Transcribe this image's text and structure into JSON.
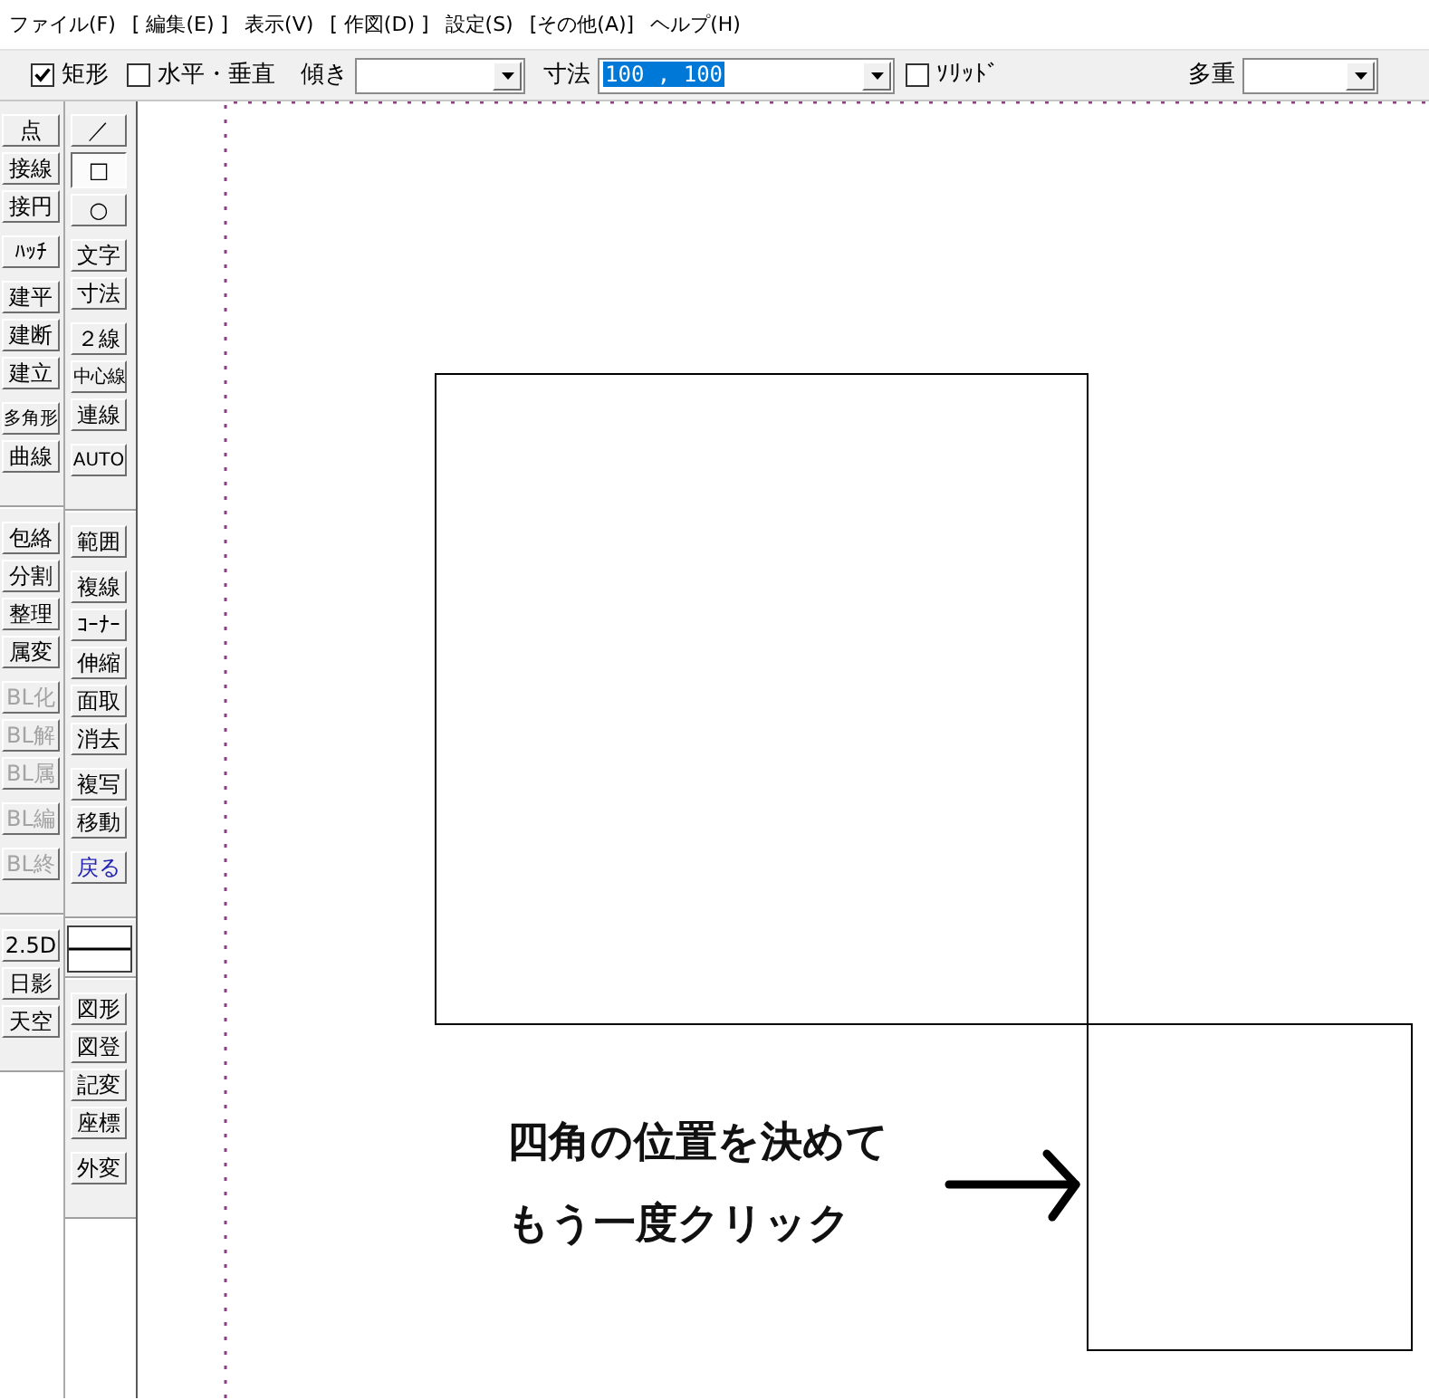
{
  "menu": [
    "ファイル(F)",
    "[ 編集(E) ]",
    "表示(V)",
    "[ 作図(D) ]",
    "設定(S)",
    "[その他(A)]",
    "ヘルプ(H)"
  ],
  "toolbar": {
    "left": [
      {
        "kind": "checkbox",
        "label": "矩形",
        "checked": true
      },
      {
        "kind": "checkbox",
        "label": "水平・垂直",
        "checked": false
      },
      {
        "kind": "combo",
        "label": "傾き"
      },
      {
        "kind": "combo",
        "label": "寸法",
        "value": "100 , 100",
        "highlighted": true
      },
      {
        "kind": "checkbox",
        "label": "ｿﾘｯﾄﾞ",
        "checked": false
      }
    ],
    "right": [
      {
        "kind": "combo",
        "label": "多重"
      }
    ]
  },
  "tool_columns": [
    {
      "groups": [
        {
          "kind": "buttons",
          "blocks": [
            [
              {
                "label": "点",
                "selected": false,
                "disabled": false
              },
              {
                "label": "接線",
                "selected": false,
                "disabled": false
              },
              {
                "label": "接円",
                "selected": false,
                "disabled": false
              }
            ],
            [
              {
                "label": "ﾊｯﾁ",
                "selected": false,
                "disabled": false
              }
            ],
            [
              {
                "label": "建平",
                "selected": false,
                "disabled": false
              },
              {
                "label": "建断",
                "selected": false,
                "disabled": false
              },
              {
                "label": "建立",
                "selected": false,
                "disabled": false
              }
            ],
            [
              {
                "label": "多角形",
                "selected": false,
                "disabled": false
              },
              {
                "label": "曲線",
                "selected": false,
                "disabled": false
              }
            ]
          ]
        },
        {
          "kind": "buttons",
          "blocks": [
            [
              {
                "label": "包絡",
                "selected": false,
                "disabled": false
              },
              {
                "label": "分割",
                "selected": false,
                "disabled": false
              },
              {
                "label": "整理",
                "selected": false,
                "disabled": false
              },
              {
                "label": "属変",
                "selected": false,
                "disabled": false
              }
            ],
            [
              {
                "label": "BL化",
                "selected": false,
                "disabled": true
              },
              {
                "label": "BL解",
                "selected": false,
                "disabled": true
              },
              {
                "label": "BL属",
                "selected": false,
                "disabled": true
              }
            ],
            [
              {
                "label": "BL編",
                "selected": false,
                "disabled": true
              }
            ],
            [
              {
                "label": "BL終",
                "selected": false,
                "disabled": true
              }
            ]
          ]
        },
        {
          "kind": "buttons",
          "blocks": [
            [
              {
                "label": "2.5D",
                "selected": false,
                "disabled": false
              },
              {
                "label": "日影",
                "selected": false,
                "disabled": false
              },
              {
                "label": "天空",
                "selected": false,
                "disabled": false
              }
            ]
          ]
        }
      ]
    },
    {
      "groups": [
        {
          "kind": "buttons",
          "blocks": [
            [
              {
                "label": "／",
                "selected": false,
                "disabled": false
              },
              {
                "label": "□",
                "selected": true,
                "disabled": false
              },
              {
                "label": "○",
                "selected": false,
                "disabled": false
              }
            ],
            [
              {
                "label": "文字",
                "selected": false,
                "disabled": false
              },
              {
                "label": "寸法",
                "selected": false,
                "disabled": false
              }
            ],
            [
              {
                "label": "２線",
                "selected": false,
                "disabled": false
              },
              {
                "label": "中心線",
                "selected": false,
                "disabled": false
              },
              {
                "label": "連線",
                "selected": false,
                "disabled": false
              }
            ],
            [
              {
                "label": "AUTO",
                "selected": false,
                "disabled": false
              }
            ]
          ]
        },
        {
          "kind": "buttons",
          "blocks": [
            [
              {
                "label": "範囲",
                "selected": false,
                "disabled": false
              }
            ],
            [
              {
                "label": "複線",
                "selected": false,
                "disabled": false
              },
              {
                "label": "ｺｰﾅｰ",
                "selected": false,
                "disabled": false
              },
              {
                "label": "伸縮",
                "selected": false,
                "disabled": false
              },
              {
                "label": "面取",
                "selected": false,
                "disabled": false
              },
              {
                "label": "消去",
                "selected": false,
                "disabled": false
              }
            ],
            [
              {
                "label": "複写",
                "selected": false,
                "disabled": false
              },
              {
                "label": "移動",
                "selected": false,
                "disabled": false
              }
            ],
            [
              {
                "label": "戻る",
                "selected": false,
                "disabled": false,
                "color": "#2323b4"
              }
            ]
          ]
        },
        {
          "kind": "line_type"
        },
        {
          "kind": "buttons",
          "blocks": [
            [
              {
                "label": "図形",
                "selected": false,
                "disabled": false
              },
              {
                "label": "図登",
                "selected": false,
                "disabled": false
              },
              {
                "label": "記変",
                "selected": false,
                "disabled": false
              },
              {
                "label": "座標",
                "selected": false,
                "disabled": false
              }
            ],
            [
              {
                "label": "外変",
                "selected": false,
                "disabled": false
              }
            ]
          ]
        }
      ]
    }
  ],
  "canvas": {
    "caption": [
      "四角の位置を決めて",
      "もう一度クリック"
    ]
  }
}
